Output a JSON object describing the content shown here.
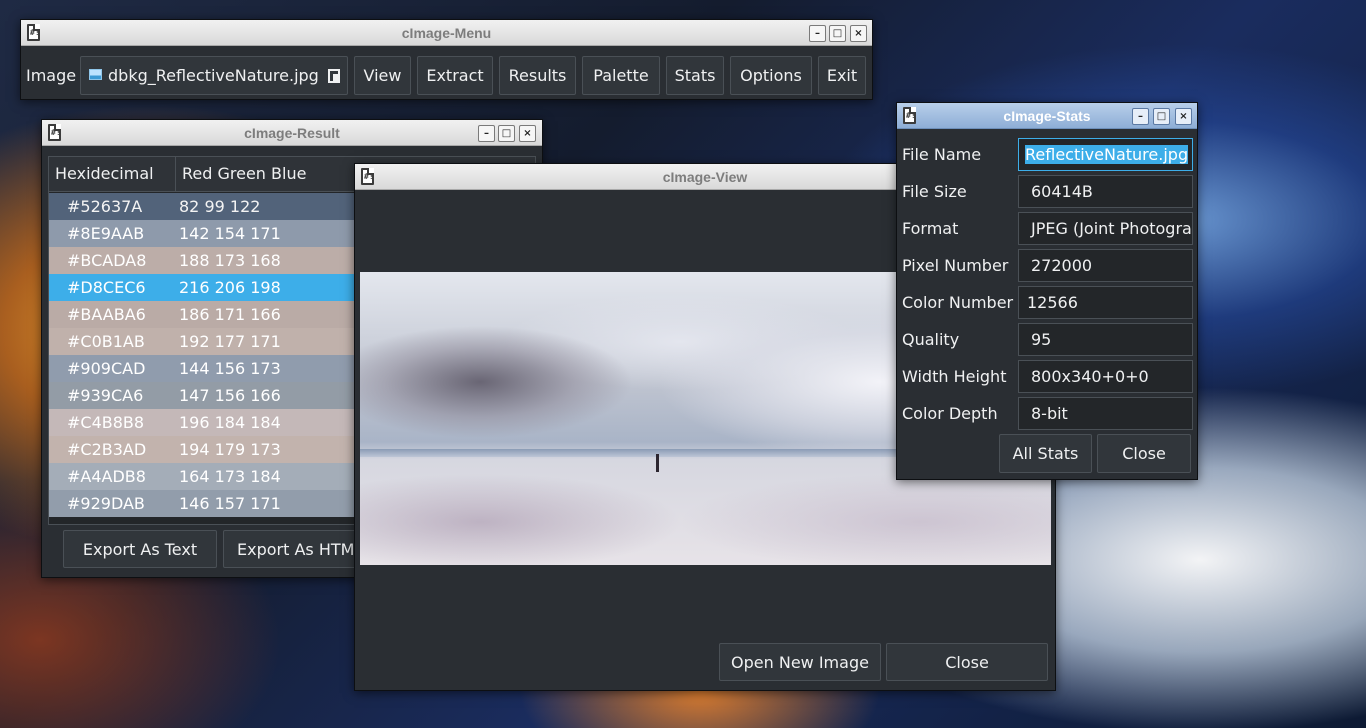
{
  "menu_window": {
    "title": "cImage-Menu",
    "image_label": "Image",
    "file_name": "dbkg_ReflectiveNature.jpg",
    "buttons": [
      "View",
      "Extract",
      "Results",
      "Palette",
      "Stats",
      "Options",
      "Exit"
    ]
  },
  "result_window": {
    "title": "cImage-Result",
    "columns": [
      "Hexidecimal",
      "Red Green Blue"
    ],
    "rows": [
      {
        "hex": "#52637A",
        "rgb": "82 99 122",
        "color": "#52637A"
      },
      {
        "hex": "#8E9AAB",
        "rgb": "142 154 171",
        "color": "#8E9AAB"
      },
      {
        "hex": "#BCADA8",
        "rgb": "188 173 168",
        "color": "#BCADA8"
      },
      {
        "hex": "#D8CEC6",
        "rgb": "216 206 198",
        "color": "#D8CEC6",
        "selected": true
      },
      {
        "hex": "#BAABA6",
        "rgb": "186 171 166",
        "color": "#BAABA6"
      },
      {
        "hex": "#C0B1AB",
        "rgb": "192 177 171",
        "color": "#C0B1AB"
      },
      {
        "hex": "#909CAD",
        "rgb": "144 156 173",
        "color": "#909CAD"
      },
      {
        "hex": "#939CA6",
        "rgb": "147 156 166",
        "color": "#939CA6"
      },
      {
        "hex": "#C4B8B8",
        "rgb": "196 184 184",
        "color": "#C4B8B8"
      },
      {
        "hex": "#C2B3AD",
        "rgb": "194 179 173",
        "color": "#C2B3AD"
      },
      {
        "hex": "#A4ADB8",
        "rgb": "164 173 184",
        "color": "#A4ADB8"
      },
      {
        "hex": "#929DAB",
        "rgb": "146 157 171",
        "color": "#929DAB"
      }
    ],
    "export_text_label": "Export As Text",
    "export_html_label": "Export As HTM"
  },
  "view_window": {
    "title": "cImage-View",
    "open_new_image_label": "Open New Image",
    "close_label": "Close"
  },
  "stats_window": {
    "title": "cImage-Stats",
    "fields": [
      {
        "label": "File Name",
        "value": "ReflectiveNature.jpg"
      },
      {
        "label": "File Size",
        "value": "60414B"
      },
      {
        "label": "Format",
        "value": "JPEG (Joint Photographic"
      },
      {
        "label": "Pixel Number",
        "value": "272000"
      },
      {
        "label": "Color Number",
        "value": "12566"
      },
      {
        "label": "Quality",
        "value": "95"
      },
      {
        "label": "Width Height",
        "value": "800x340+0+0"
      },
      {
        "label": "Color Depth",
        "value": "8-bit"
      }
    ],
    "all_stats_label": "All Stats",
    "close_label": "Close"
  },
  "colors": {
    "selection": "#3daee9",
    "window_bg": "#2a2e33",
    "button_bg": "#31363b"
  }
}
